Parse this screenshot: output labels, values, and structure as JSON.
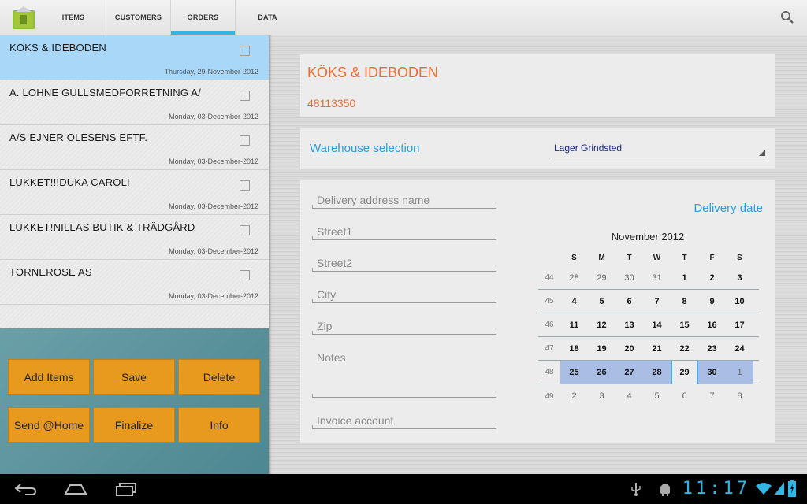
{
  "tabs": [
    {
      "label": "ITEMS"
    },
    {
      "label": "CUSTOMERS"
    },
    {
      "label": "ORDERS"
    },
    {
      "label": "DATA"
    }
  ],
  "active_tab": "ORDERS",
  "orders": [
    {
      "name": "KÖKS & IDEBODEN",
      "date": "Thursday, 29-November-2012",
      "selected": true
    },
    {
      "name": "A. LOHNE GULLSMEDFORRETNING A/",
      "date": "Monday, 03-December-2012"
    },
    {
      "name": "A/S EJNER OLESENS EFTF.",
      "date": "Monday, 03-December-2012"
    },
    {
      "name": "LUKKET!!!DUKA CAROLI",
      "date": "Monday, 03-December-2012"
    },
    {
      "name": "LUKKET!NILLAS BUTIK & TRÄDGÅRD",
      "date": "Monday, 03-December-2012"
    },
    {
      "name": "TORNEROSE AS",
      "date": "Monday, 03-December-2012"
    }
  ],
  "buttons": {
    "add_items": "Add Items",
    "save": "Save",
    "delete": "Delete",
    "send_home": "Send @Home",
    "finalize": "Finalize",
    "info": "Info"
  },
  "customer": {
    "name": "KÖKS & IDEBODEN",
    "phone": "48113350"
  },
  "warehouse": {
    "label": "Warehouse selection",
    "value": "Lager Grindsted"
  },
  "form": {
    "delivery_address_name": "Delivery address name",
    "street1": "Street1",
    "street2": "Street2",
    "city": "City",
    "zip": "Zip",
    "notes": "Notes",
    "invoice_account": "Invoice account"
  },
  "calendar": {
    "label": "Delivery date",
    "month_title": "November 2012",
    "weekdays": [
      "S",
      "M",
      "T",
      "W",
      "T",
      "F",
      "S"
    ],
    "weeks": [
      {
        "wk": "44",
        "days": [
          "28",
          "29",
          "30",
          "31",
          "1",
          "2",
          "3"
        ]
      },
      {
        "wk": "45",
        "days": [
          "4",
          "5",
          "6",
          "7",
          "8",
          "9",
          "10"
        ]
      },
      {
        "wk": "46",
        "days": [
          "11",
          "12",
          "13",
          "14",
          "15",
          "16",
          "17"
        ]
      },
      {
        "wk": "47",
        "days": [
          "18",
          "19",
          "20",
          "21",
          "22",
          "23",
          "24"
        ]
      },
      {
        "wk": "48",
        "days": [
          "25",
          "26",
          "27",
          "28",
          "29",
          "30",
          "1"
        ]
      },
      {
        "wk": "49",
        "days": [
          "2",
          "3",
          "4",
          "5",
          "6",
          "7",
          "8"
        ]
      }
    ]
  },
  "status_bar": {
    "time": "11:17"
  },
  "colors": {
    "accent": "#33b5e5",
    "orange_button": "#e79a1e",
    "customer_text": "#ee6a2c",
    "label_blue": "#2c9ee0",
    "selected_row": "#a8d7f7"
  }
}
